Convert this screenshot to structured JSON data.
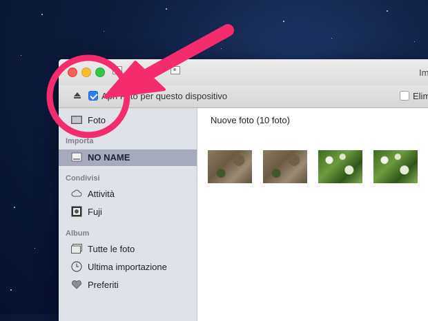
{
  "window": {
    "title": "Im"
  },
  "toolbar": {
    "open_photos_label": "Apri Foto per questo dispositivo",
    "open_photos_checked": true,
    "delete_label": "Elim",
    "delete_checked": false
  },
  "sidebar": {
    "foto_label": "Foto",
    "import_header": "Importa",
    "device_label": "NO NAME",
    "shared_header": "Condivisi",
    "activity_label": "Attività",
    "fuji_label": "Fuji",
    "album_header": "Album",
    "all_photos_label": "Tutte le foto",
    "last_import_label": "Ultima importazione",
    "favorites_label": "Preferiti"
  },
  "content": {
    "title": "Nuove foto (10 foto)"
  },
  "annotation_color": "#f42c6e"
}
